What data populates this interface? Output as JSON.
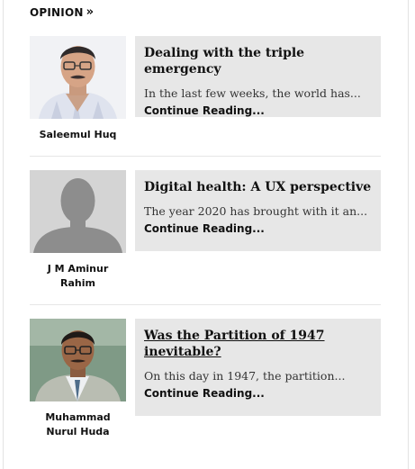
{
  "section": {
    "title": "OPINION",
    "arrow_icon": "double-chevron-right-icon"
  },
  "articles": [
    {
      "author": "Saleemul Huq",
      "title": "Dealing with the triple emergency",
      "excerpt": "In the last few weeks, the world has...",
      "more": "Continue Reading..."
    },
    {
      "author": "J M Aminur Rahim",
      "title": "Digital health: A UX perspective",
      "excerpt": "The year 2020 has brought with it an...",
      "more": "Continue Reading..."
    },
    {
      "author": "Muhammad Nurul Huda",
      "title": "Was the Partition of 1947 inevitable?",
      "excerpt": "On this day in 1947, the partition...",
      "more": "Continue Reading..."
    }
  ],
  "colors": {
    "card_bg": "#e7e7e7",
    "text": "#111111",
    "divider": "#e6e6e6"
  }
}
